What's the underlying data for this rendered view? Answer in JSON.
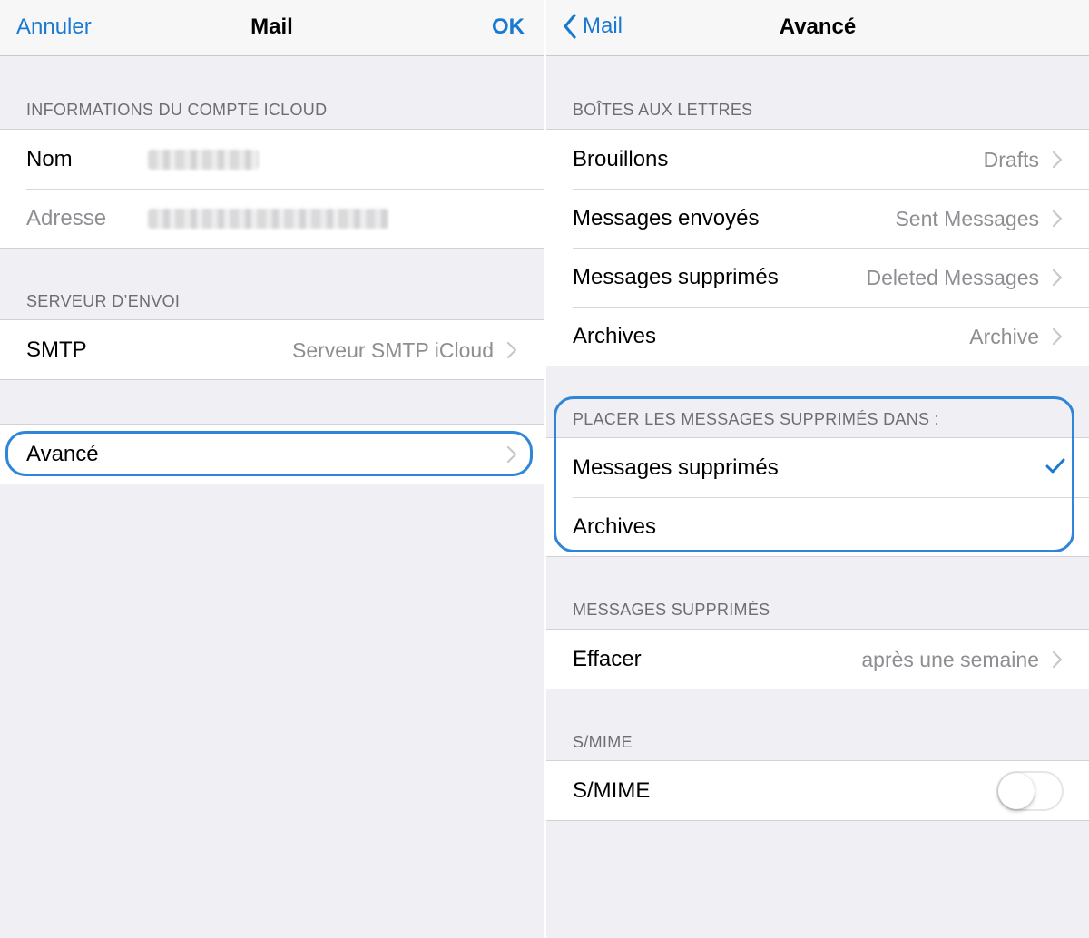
{
  "colors": {
    "accent": "#1a7ad0",
    "highlight": "#2f86d8",
    "background": "#efeff4"
  },
  "left": {
    "nav": {
      "cancel": "Annuler",
      "title": "Mail",
      "ok": "OK"
    },
    "section_icloud": "INFORMATIONS DU COMPTE ICLOUD",
    "nom_label": "Nom",
    "adresse_label": "Adresse",
    "section_envoi": "SERVEUR D’ENVOI",
    "smtp_label": "SMTP",
    "smtp_value": "Serveur SMTP iCloud",
    "avance_label": "Avancé"
  },
  "right": {
    "nav": {
      "back": "Mail",
      "title": "Avancé"
    },
    "section_boites": "BOÎTES AUX LETTRES",
    "boites": [
      {
        "label": "Brouillons",
        "value": "Drafts"
      },
      {
        "label": "Messages envoyés",
        "value": "Sent Messages"
      },
      {
        "label": "Messages supprimés",
        "value": "Deleted Messages"
      },
      {
        "label": "Archives",
        "value": "Archive"
      }
    ],
    "section_placer": "PLACER LES MESSAGES SUPPRIMÉS DANS :",
    "placer": [
      {
        "label": "Messages supprimés",
        "selected": true
      },
      {
        "label": "Archives",
        "selected": false
      }
    ],
    "section_supprimes": "MESSAGES SUPPRIMÉS",
    "effacer_label": "Effacer",
    "effacer_value": "après une semaine",
    "section_smime": "S/MIME",
    "smime_label": "S/MIME",
    "smime_enabled": false
  }
}
